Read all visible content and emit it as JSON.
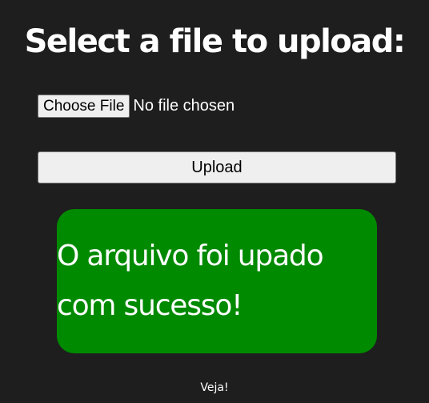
{
  "page": {
    "title": "Select a file to upload:",
    "background_color": "#1e1e1e"
  },
  "file_input": {
    "button_label": "Choose File",
    "status_text": "No file chosen"
  },
  "upload_button": {
    "label": "Upload"
  },
  "success_message": {
    "text": "O arquivo foi upado com sucesso!",
    "background_color": "#008a00"
  },
  "footer": {
    "text": "Veja!"
  }
}
